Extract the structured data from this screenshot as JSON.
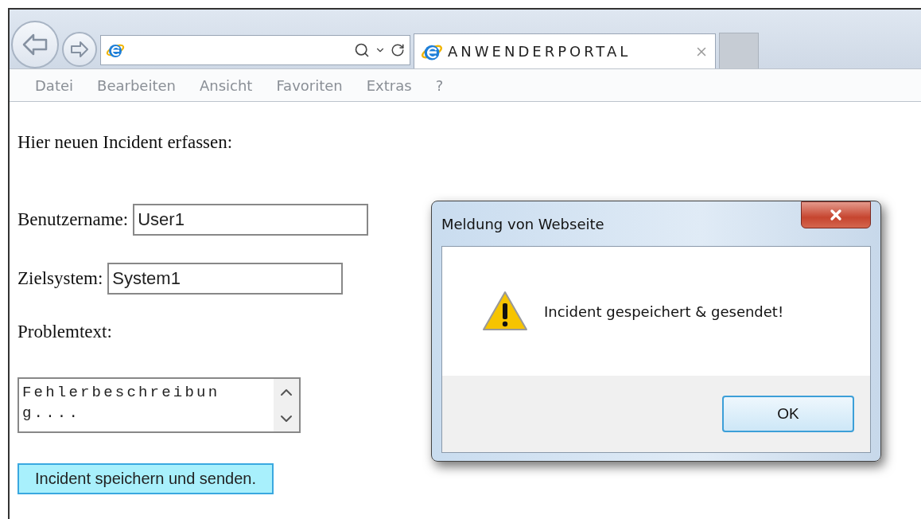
{
  "browser": {
    "tabs": [
      {
        "label": "ANWENDERPORTAL",
        "selected": true
      }
    ]
  },
  "menu": [
    "Datei",
    "Bearbeiten",
    "Ansicht",
    "Favoriten",
    "Extras",
    "?"
  ],
  "page": {
    "heading": "Hier neuen Incident erfassen:",
    "fields": [
      {
        "kind": "input",
        "label": "Benutzername:",
        "value": "User1"
      },
      {
        "kind": "input",
        "label": "Zielsystem:",
        "value": "System1"
      },
      {
        "kind": "label",
        "label": "Problemtext:"
      },
      {
        "kind": "textarea",
        "value": "Fehlerbeschreibung...."
      }
    ],
    "submit": "Incident speichern und senden."
  },
  "dialog": {
    "title": "Meldung von Webseite",
    "message": "Incident gespeichert & gesendet!",
    "buttons": [
      "OK"
    ]
  }
}
